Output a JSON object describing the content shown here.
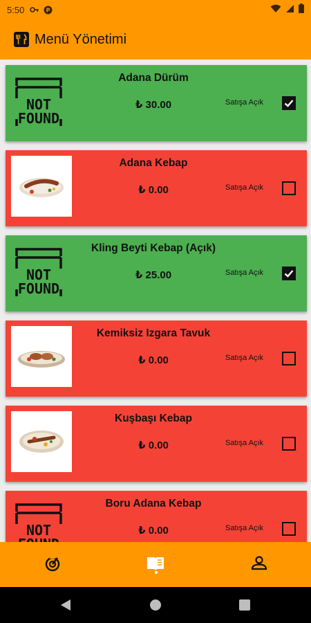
{
  "status_bar": {
    "time": "5:50"
  },
  "app_bar": {
    "title": "Menü Yönetimi",
    "icon": "restaurant-menu-icon"
  },
  "placeholder_text": {
    "line1": "NOT",
    "line2": "FOUND"
  },
  "items": [
    {
      "name": "Adana Dürüm",
      "price": "₺ 30.00",
      "sale_label": "Satışa Açık",
      "on_sale": true,
      "image": "not-found"
    },
    {
      "name": "Adana Kebap",
      "price": "₺ 0.00",
      "sale_label": "Satışa Açık",
      "on_sale": false,
      "image": "photo"
    },
    {
      "name": "Kling Beyti Kebap (Açık)",
      "price": "₺ 25.00",
      "sale_label": "Satışa Açık",
      "on_sale": true,
      "image": "not-found"
    },
    {
      "name": "Kemiksiz Izgara Tavuk",
      "price": "₺ 0.00",
      "sale_label": "Satışa Açık",
      "on_sale": false,
      "image": "photo"
    },
    {
      "name": "Kuşbaşı Kebap",
      "price": "₺ 0.00",
      "sale_label": "Satışa Açık",
      "on_sale": false,
      "image": "photo"
    },
    {
      "name": "Boru Adana Kebap",
      "price": "₺ 0.00",
      "sale_label": "Satışa Açık",
      "on_sale": false,
      "image": "not-found"
    }
  ],
  "colors": {
    "accent": "#ff9800",
    "open": "#4caf50",
    "closed": "#f44336"
  },
  "bottom_nav": [
    {
      "icon": "dashboard-icon",
      "selected": false
    },
    {
      "icon": "menu-book-icon",
      "selected": true
    },
    {
      "icon": "profile-icon",
      "selected": false
    }
  ]
}
